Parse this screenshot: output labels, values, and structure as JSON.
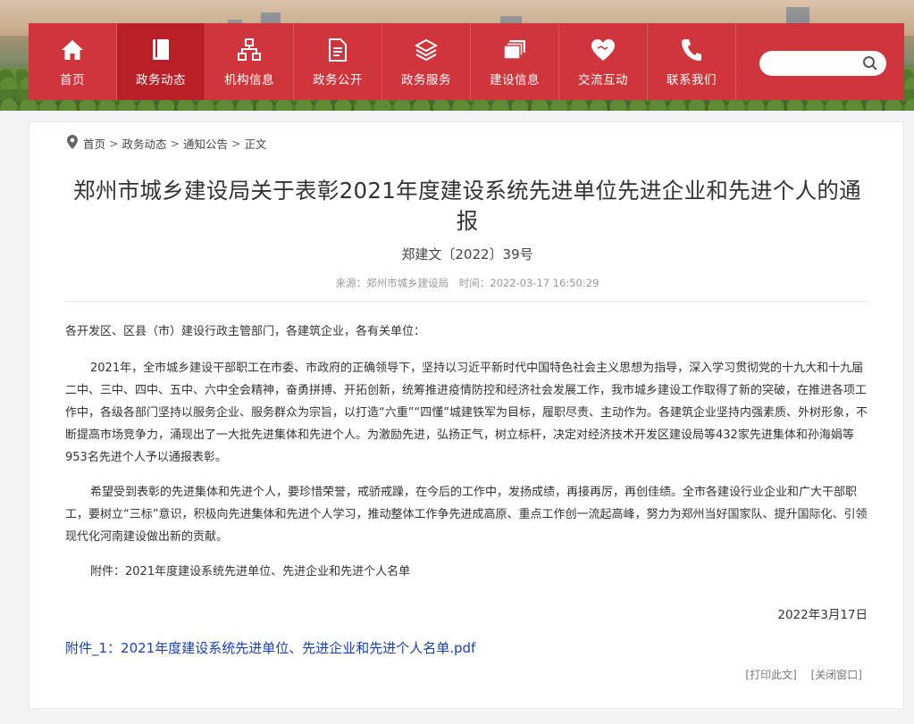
{
  "nav": {
    "items": [
      {
        "label": "首页",
        "icon": "home-icon"
      },
      {
        "label": "政务动态",
        "icon": "book-icon"
      },
      {
        "label": "机构信息",
        "icon": "org-chart-icon"
      },
      {
        "label": "政务公开",
        "icon": "document-icon"
      },
      {
        "label": "政务服务",
        "icon": "layers-icon"
      },
      {
        "label": "建设信息",
        "icon": "stacked-cards-icon"
      },
      {
        "label": "交流互动",
        "icon": "handshake-heart-icon"
      },
      {
        "label": "联系我们",
        "icon": "phone-icon"
      }
    ],
    "active_index": 1,
    "search_placeholder": ""
  },
  "breadcrumb": {
    "items": [
      "首页",
      "政务动态",
      "通知公告",
      "正文"
    ],
    "separator": ">"
  },
  "article": {
    "title": "郑州市城乡建设局关于表彰2021年度建设系统先进单位先进企业和先进个人的通报",
    "doc_number": "郑建文〔2022〕39号",
    "source": "来源：郑州市城乡建设局",
    "time": "时间：2022-03-17 16:50:29",
    "salutation": "各开发区、区县（市）建设行政主管部门，各建筑企业，各有关单位：",
    "paragraph1": "2021年，全市城乡建设干部职工在市委、市政府的正确领导下，坚持以习近平新时代中国特色社会主义思想为指导，深入学习贯彻党的十九大和十九届二中、三中、四中、五中、六中全会精神，奋勇拼搏、开拓创新，统筹推进疫情防控和经济社会发展工作，我市城乡建设工作取得了新的突破，在推进各项工作中，各级各部门坚持以服务企业、服务群众为宗旨，以打造“六重”“四懂”城建铁军为目标，履职尽责、主动作为。各建筑企业坚持内强素质、外树形象，不断提高市场竞争力，涌现出了一大批先进集体和先进个人。为激励先进，弘扬正气，树立标杆，决定对经济技术开发区建设局等432家先进集体和孙海娟等953名先进个人予以通报表彰。",
    "paragraph2": "希望受到表彰的先进集体和先进个人，要珍惜荣誉，戒骄戒躁，在今后的工作中，发扬成绩，再接再厉，再创佳绩。全市各建设行业企业和广大干部职工，要树立“三标”意识，积极向先进集体和先进个人学习，推动整体工作争先进成高原、重点工作创一流起高峰，努力为郑州当好国家队、提升国际化、引领现代化河南建设做出新的贡献。",
    "attachment_note": "附件：2021年度建设系统先进单位、先进企业和先进个人名单",
    "date": "2022年3月17日",
    "attachment_link": "附件_1：2021年度建设系统先进单位、先进企业和先进个人名单.pdf",
    "print_label": "[打印此文]",
    "close_label": "[关闭窗口]"
  },
  "colors": {
    "nav_bg": "#d0353b",
    "nav_active": "#b81f27",
    "link": "#1a3fb5"
  }
}
